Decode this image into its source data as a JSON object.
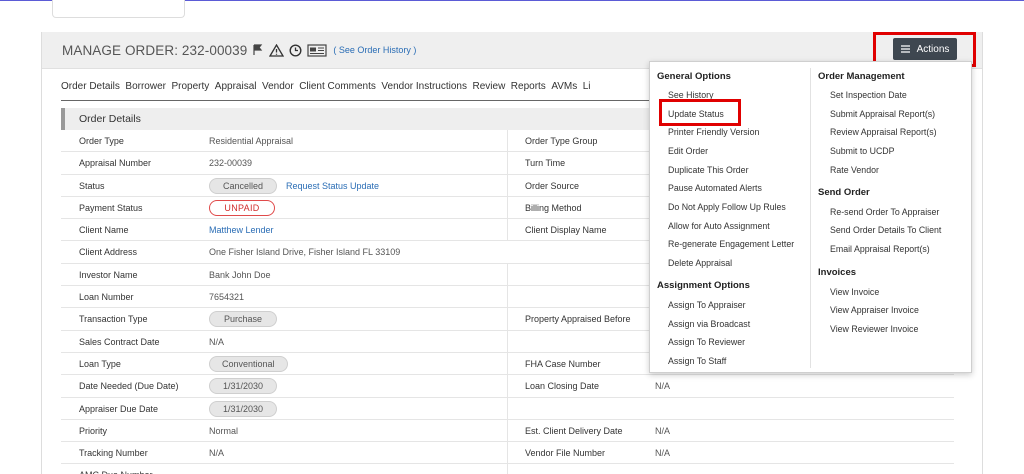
{
  "header": {
    "title": "MANAGE ORDER: 232-00039",
    "history_link": "( See Order History )",
    "actions_label": "Actions"
  },
  "tabs": [
    "Order Details",
    "Borrower",
    "Property",
    "Appraisal",
    "Vendor",
    "Client Comments",
    "Vendor Instructions",
    "Review",
    "Reports",
    "AVMs",
    "Li"
  ],
  "section": {
    "title": "Order Details"
  },
  "rows": [
    {
      "l1": "Order Type",
      "v1": "Residential Appraisal",
      "l2": "Order Type Group",
      "v2": ""
    },
    {
      "l1": "Appraisal Number",
      "v1": "232-00039",
      "l2": "Turn Time",
      "v2": ""
    },
    {
      "l1": "Status",
      "v1": "Cancelled",
      "link": "Request Status Update",
      "l2": "Order Source",
      "v2": ""
    },
    {
      "l1": "Payment Status",
      "v1": "UNPAID",
      "l2": "Billing Method",
      "v2": ""
    },
    {
      "l1": "Client Name",
      "v1": "Matthew Lender",
      "l2": "Client Display Name",
      "v2": ""
    },
    {
      "l1": "Client Address",
      "v1": "One Fisher Island Drive, Fisher Island FL 33109",
      "l2": "",
      "v2": ""
    },
    {
      "l1": "Investor Name",
      "v1": "Bank John Doe",
      "l2": "",
      "v2": ""
    },
    {
      "l1": "Loan Number",
      "v1": "7654321",
      "l2": "",
      "v2": ""
    },
    {
      "l1": "Transaction Type",
      "v1": "Purchase",
      "l2": "Property Appraised Before",
      "v2": ""
    },
    {
      "l1": "Sales Contract Date",
      "v1": "N/A",
      "l2": "",
      "v2": ""
    },
    {
      "l1": "Loan Type",
      "v1": "Conventional",
      "l2": "FHA Case Number",
      "v2": ""
    },
    {
      "l1": "Date Needed (Due Date)",
      "v1": "1/31/2030",
      "l2": "Loan Closing Date",
      "v2": "N/A"
    },
    {
      "l1": "Appraiser Due Date",
      "v1": "1/31/2030",
      "l2": "",
      "v2": ""
    },
    {
      "l1": "Priority",
      "v1": "Normal",
      "l2": "Est. Client Delivery Date",
      "v2": "N/A"
    },
    {
      "l1": "Tracking Number",
      "v1": "N/A",
      "l2": "Vendor File Number",
      "v2": "N/A"
    },
    {
      "l1": "AMC Due Number",
      "v1": "",
      "l2": "",
      "v2": ""
    }
  ],
  "dropdown": {
    "general_title": "General Options",
    "general_items": [
      "See History",
      "Update Status",
      "Printer Friendly Version",
      "Edit Order",
      "Duplicate This Order",
      "Pause Automated Alerts",
      "Do Not Apply Follow Up Rules",
      "Allow for Auto Assignment",
      "Re-generate Engagement Letter",
      "Delete Appraisal"
    ],
    "assign_title": "Assignment Options",
    "assign_items": [
      "Assign To Appraiser",
      "Assign via Broadcast",
      "Assign To Reviewer",
      "Assign To Staff"
    ],
    "mgmt_title": "Order Management",
    "mgmt_items": [
      "Set Inspection Date",
      "Submit Appraisal Report(s)",
      "Review Appraisal Report(s)",
      "Submit to UCDP",
      "Rate Vendor"
    ],
    "send_title": "Send Order",
    "send_items": [
      "Re-send Order To Appraiser",
      "Send Order Details To Client",
      "Email Appraisal Report(s)"
    ],
    "inv_title": "Invoices",
    "inv_items": [
      "View Invoice",
      "View Appraiser Invoice",
      "View Reviewer Invoice"
    ]
  }
}
